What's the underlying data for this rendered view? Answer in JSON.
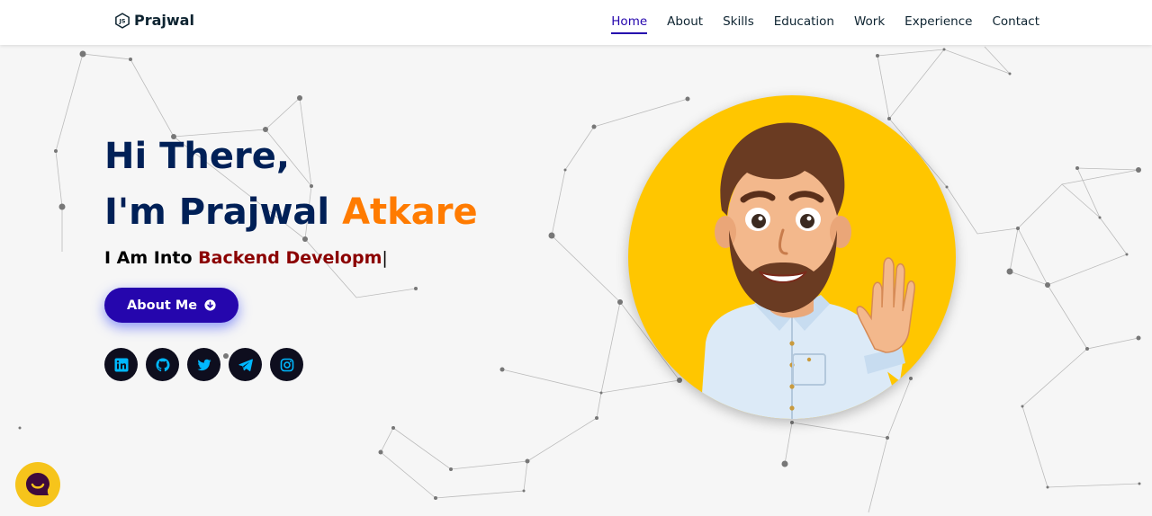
{
  "brand": {
    "name": "Prajwal",
    "logo_icon": "js-hexagon-icon"
  },
  "nav": {
    "items": [
      {
        "label": "Home",
        "active": true
      },
      {
        "label": "About",
        "active": false
      },
      {
        "label": "Skills",
        "active": false
      },
      {
        "label": "Education",
        "active": false
      },
      {
        "label": "Work",
        "active": false
      },
      {
        "label": "Experience",
        "active": false
      },
      {
        "label": "Contact",
        "active": false
      }
    ]
  },
  "hero": {
    "greeting": "Hi There,",
    "intro_prefix": "I'm Prajwal",
    "intro_accent": "Atkare",
    "into_prefix": "I Am Into",
    "into_role": "Backend Developm",
    "cursor": "|",
    "about_button": "About Me"
  },
  "socials": [
    {
      "icon": "linkedin-icon"
    },
    {
      "icon": "github-icon"
    },
    {
      "icon": "twitter-icon"
    },
    {
      "icon": "telegram-icon"
    },
    {
      "icon": "instagram-icon"
    }
  ],
  "colors": {
    "heading": "#002057",
    "accent": "#ff7b00",
    "role": "#8b0000",
    "button": "#2506ad",
    "nav_active": "#2506ad",
    "avatar_bg": "#ffc600",
    "social_icon": "#00b8ff",
    "chat_bg": "#f6c41b"
  },
  "chat": {
    "icon": "chat-bubble-icon"
  }
}
